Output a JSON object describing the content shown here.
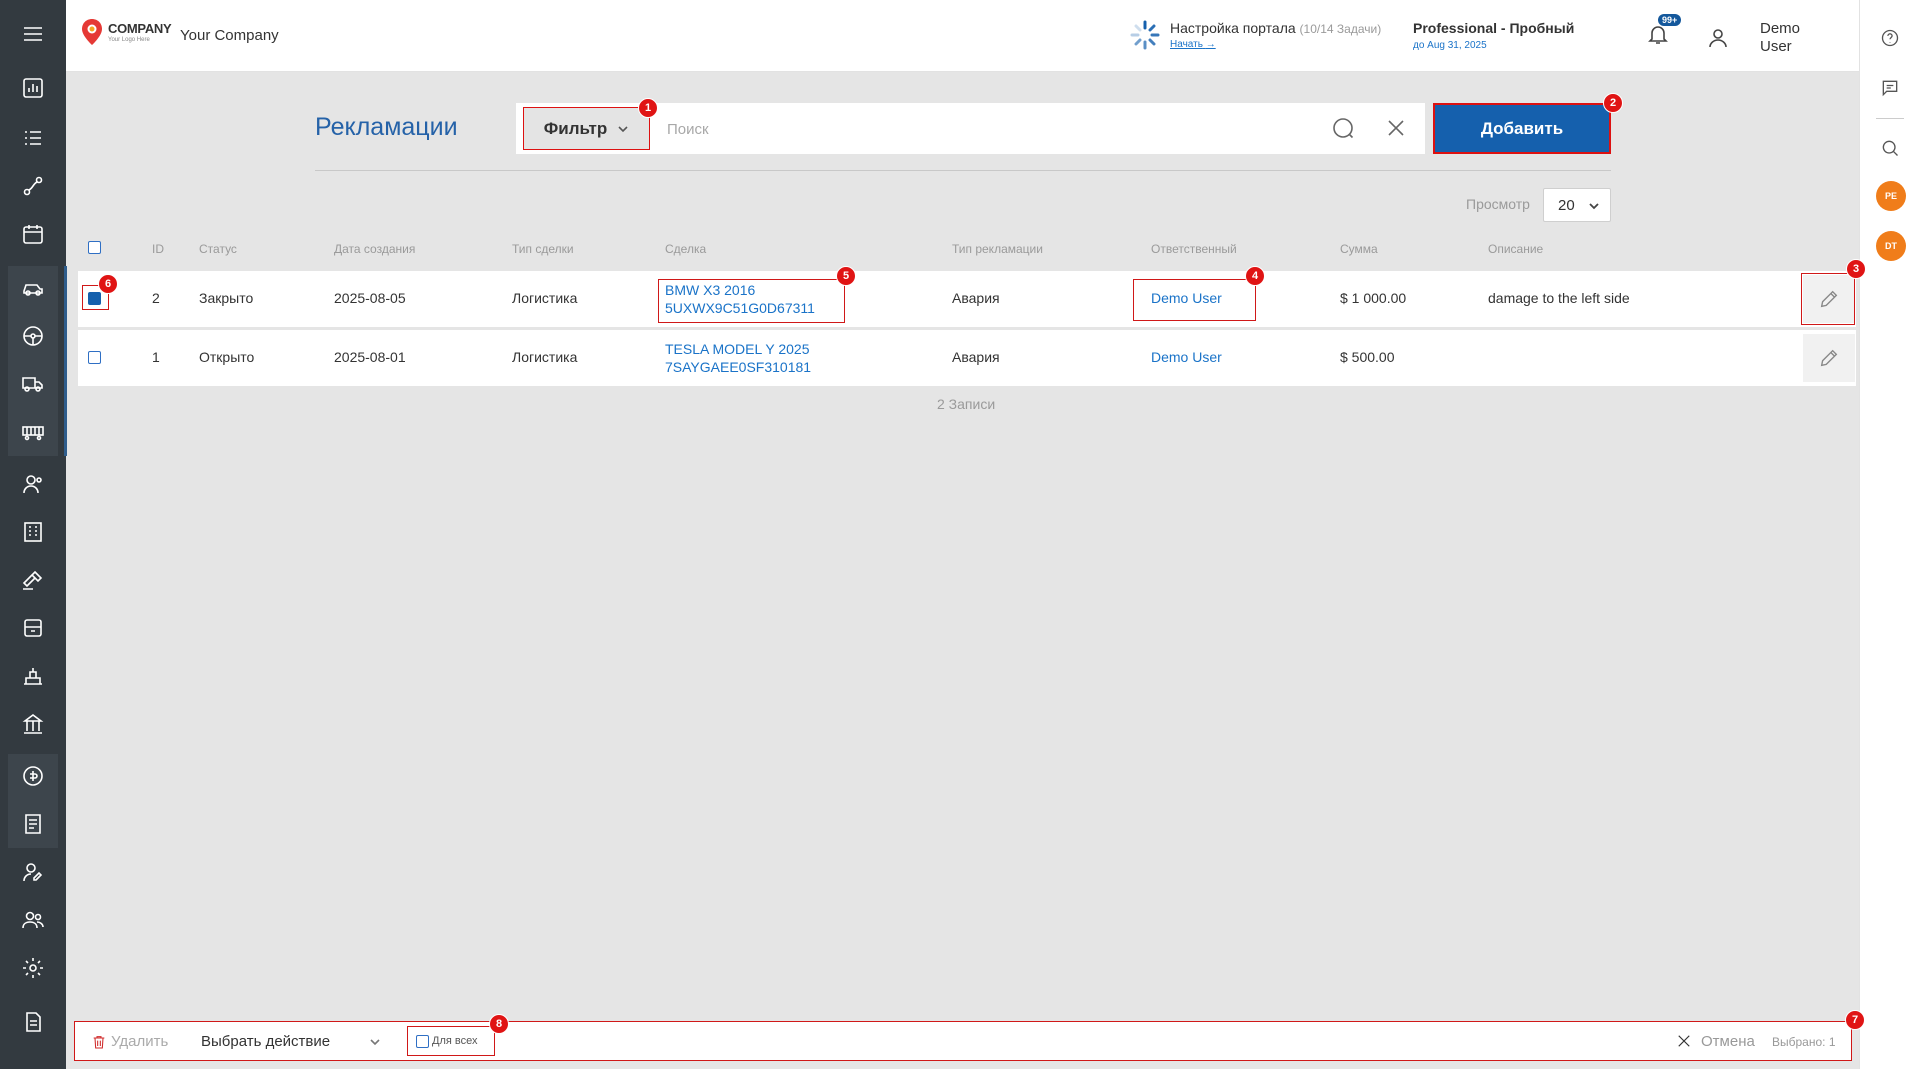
{
  "header": {
    "logo_text": "COMPANY",
    "logo_tagline": "Your Logo Here",
    "company_name": "Your Company",
    "setup_title": "Настройка портала",
    "setup_tasks": "(10/14 Задачи)",
    "setup_link": "Начать",
    "plan_name": "Professional - Пробный",
    "plan_until": "до Aug 31, 2025",
    "notifications_badge": "99+",
    "user_name": "Demo User"
  },
  "rail": {
    "avatars": [
      "PE",
      "DT"
    ]
  },
  "page": {
    "title": "Рекламации",
    "filter_label": "Фильтр",
    "search_placeholder": "Поиск",
    "add_label": "Добавить",
    "view_label": "Просмотр",
    "view_value": "20",
    "records_count": "2 Записи"
  },
  "table": {
    "columns": [
      "ID",
      "Статус",
      "Дата создания",
      "Тип сделки",
      "Сделка",
      "Тип рекламации",
      "Ответственный",
      "Сумма",
      "Описание"
    ],
    "rows": [
      {
        "id": "2",
        "status": "Закрыто",
        "created": "2025-08-05",
        "deal_type": "Логистика",
        "deal_line1": "BMW X3 2016",
        "deal_line2": "5UXWX9C51G0D67311",
        "claim_type": "Авария",
        "responsible": "Demo User",
        "amount": "$ 1 000.00",
        "description": "damage to the left side",
        "checked": true
      },
      {
        "id": "1",
        "status": "Открыто",
        "created": "2025-08-01",
        "deal_type": "Логистика",
        "deal_line1": "TESLA MODEL Y 2025",
        "deal_line2": "7SAYGAEE0SF310181",
        "claim_type": "Авария",
        "responsible": "Demo User",
        "amount": "$ 500.00",
        "description": "",
        "checked": false
      }
    ]
  },
  "bottom": {
    "delete_label": "Удалить",
    "action_label": "Выбрать действие",
    "for_all_label": "Для всех",
    "cancel_label": "Отмена",
    "selected_label": "Выбрано: 1"
  },
  "markers": [
    "1",
    "2",
    "3",
    "4",
    "5",
    "6",
    "7",
    "8"
  ],
  "colors": {
    "accent": "#1560ad",
    "sidebar": "#333a40",
    "annotation": "#d01818",
    "link": "#1a73c8"
  }
}
